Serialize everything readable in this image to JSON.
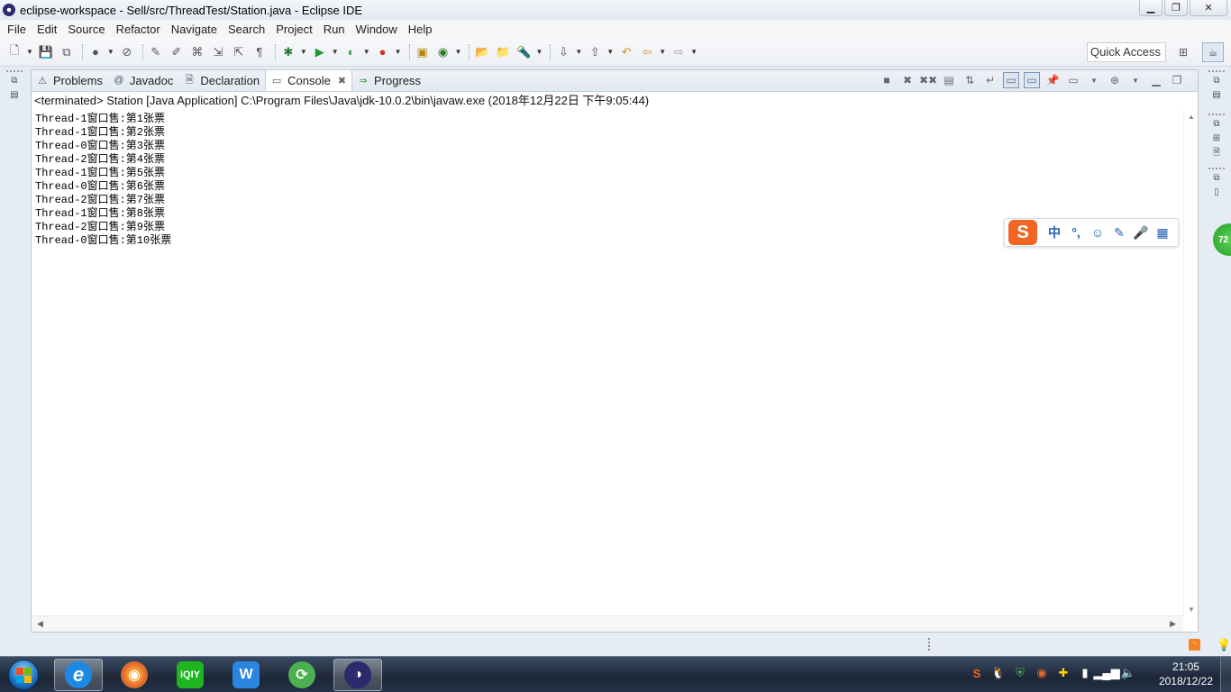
{
  "window": {
    "title": "eclipse-workspace - Sell/src/ThreadTest/Station.java - Eclipse IDE",
    "minimize": "▁",
    "maximize": "❐",
    "close": "✕"
  },
  "menu": [
    "File",
    "Edit",
    "Source",
    "Refactor",
    "Navigate",
    "Search",
    "Project",
    "Run",
    "Window",
    "Help"
  ],
  "toolbar": {
    "quick_access": "Quick Access"
  },
  "tabs": [
    {
      "label": "Problems",
      "icon": "problems-icon",
      "glyph": "⚠"
    },
    {
      "label": "Javadoc",
      "icon": "at-icon",
      "glyph": "@"
    },
    {
      "label": "Declaration",
      "icon": "declaration-icon",
      "glyph": "🗎"
    },
    {
      "label": "Console",
      "icon": "console-icon",
      "glyph": "▭",
      "active": true,
      "close": "✖"
    },
    {
      "label": "Progress",
      "icon": "progress-icon",
      "glyph": "⇒"
    }
  ],
  "console": {
    "status": "<terminated> Station [Java Application] C:\\Program Files\\Java\\jdk-10.0.2\\bin\\javaw.exe (2018年12月22日 下午9:05:44)",
    "lines": [
      "Thread-1窗口售:第1张票",
      "Thread-1窗口售:第2张票",
      "Thread-0窗口售:第3张票",
      "Thread-2窗口售:第4张票",
      "Thread-1窗口售:第5张票",
      "Thread-0窗口售:第6张票",
      "Thread-2窗口售:第7张票",
      "Thread-1窗口售:第8张票",
      "Thread-2窗口售:第9张票",
      "Thread-0窗口售:第10张票"
    ]
  },
  "ime": {
    "logo": "S",
    "mode": "中",
    "punct": "°,",
    "emoji": "☺",
    "pen": "✎",
    "mic": "🎤",
    "grid": "▦"
  },
  "side_badge": "72",
  "taskbar": {
    "time": "21:05",
    "date": "2018/12/22",
    "apps": [
      {
        "name": "ie-icon",
        "label": "e",
        "color": "#1e88e5"
      },
      {
        "name": "browser-ball-icon",
        "label": "◉",
        "color": "#e8662a"
      },
      {
        "name": "iqiyi-icon",
        "label": "iQIY",
        "color": "#1fb51f"
      },
      {
        "name": "w-app-icon",
        "label": "W",
        "color": "#2a86e0"
      },
      {
        "name": "refresh-app-icon",
        "label": "⟳",
        "color": "#4caf50"
      },
      {
        "name": "eclipse-icon",
        "label": "◑",
        "color": "#2c2a6d"
      }
    ]
  }
}
